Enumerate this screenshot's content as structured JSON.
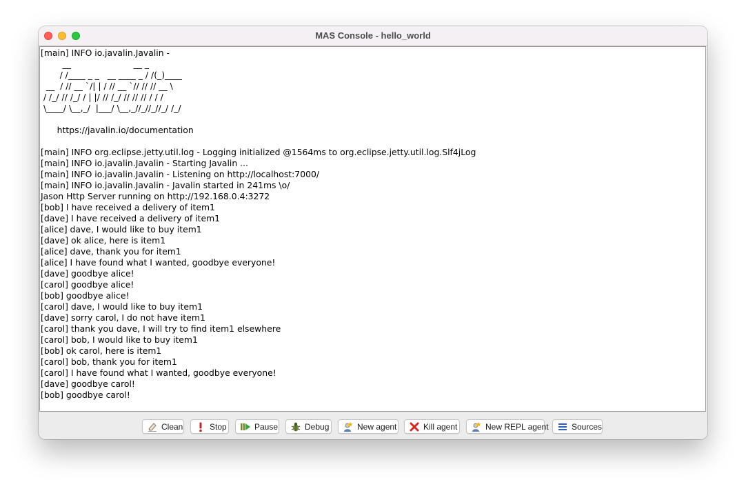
{
  "window": {
    "title": "MAS Console - hello_world"
  },
  "console": {
    "lines": [
      "[main] INFO io.javalin.Javalin -",
      "        __                       __ _",
      "       / /____ _ _   __ ____ _ / /(_)____",
      "  __  / // __ `/| | / // __ `// // // __ \\",
      " / /_/ // /_/ / | |/ // /_/ // // // / / /",
      " \\____/ \\__,_/  |___/ \\__,_//_//_//_/ /_/",
      "",
      "      https://javalin.io/documentation",
      "",
      "[main] INFO org.eclipse.jetty.util.log - Logging initialized @1564ms to org.eclipse.jetty.util.log.Slf4jLog",
      "[main] INFO io.javalin.Javalin - Starting Javalin ...",
      "[main] INFO io.javalin.Javalin - Listening on http://localhost:7000/",
      "[main] INFO io.javalin.Javalin - Javalin started in 241ms \\o/",
      "Jason Http Server running on http://192.168.0.4:3272",
      "[bob] I have received a delivery of item1",
      "[dave] I have received a delivery of item1",
      "[alice] dave, I would like to buy item1",
      "[dave] ok alice, here is item1",
      "[alice] dave, thank you for item1",
      "[alice] I have found what I wanted, goodbye everyone!",
      "[dave] goodbye alice!",
      "[carol] goodbye alice!",
      "[bob] goodbye alice!",
      "[carol] dave, I would like to buy item1",
      "[dave] sorry carol, I do not have item1",
      "[carol] thank you dave, I will try to find item1 elsewhere",
      "[carol] bob, I would like to buy item1",
      "[bob] ok carol, here is item1",
      "[carol] bob, thank you for item1",
      "[carol] I have found what I wanted, goodbye everyone!",
      "[dave] goodbye carol!",
      "[bob] goodbye carol!"
    ]
  },
  "toolbar": {
    "clean_label": "Clean",
    "stop_label": "Stop",
    "pause_label": "Pause",
    "debug_label": "Debug",
    "new_agent_label": "New agent",
    "kill_agent_label": "Kill agent",
    "new_repl_agent_label": "New REPL agent",
    "sources_label": "Sources",
    "icons": [
      "eraser-icon",
      "exclamation-icon",
      "play-pause-icon",
      "bug-icon",
      "new-agent-icon",
      "red-x-icon",
      "new-repl-agent-icon",
      "list-icon"
    ]
  },
  "colors": {
    "close": "#ff5f57",
    "minimize": "#febc2e",
    "maximize": "#28c840",
    "kill_red": "#d9231f",
    "sources_blue": "#2f5fb3"
  }
}
